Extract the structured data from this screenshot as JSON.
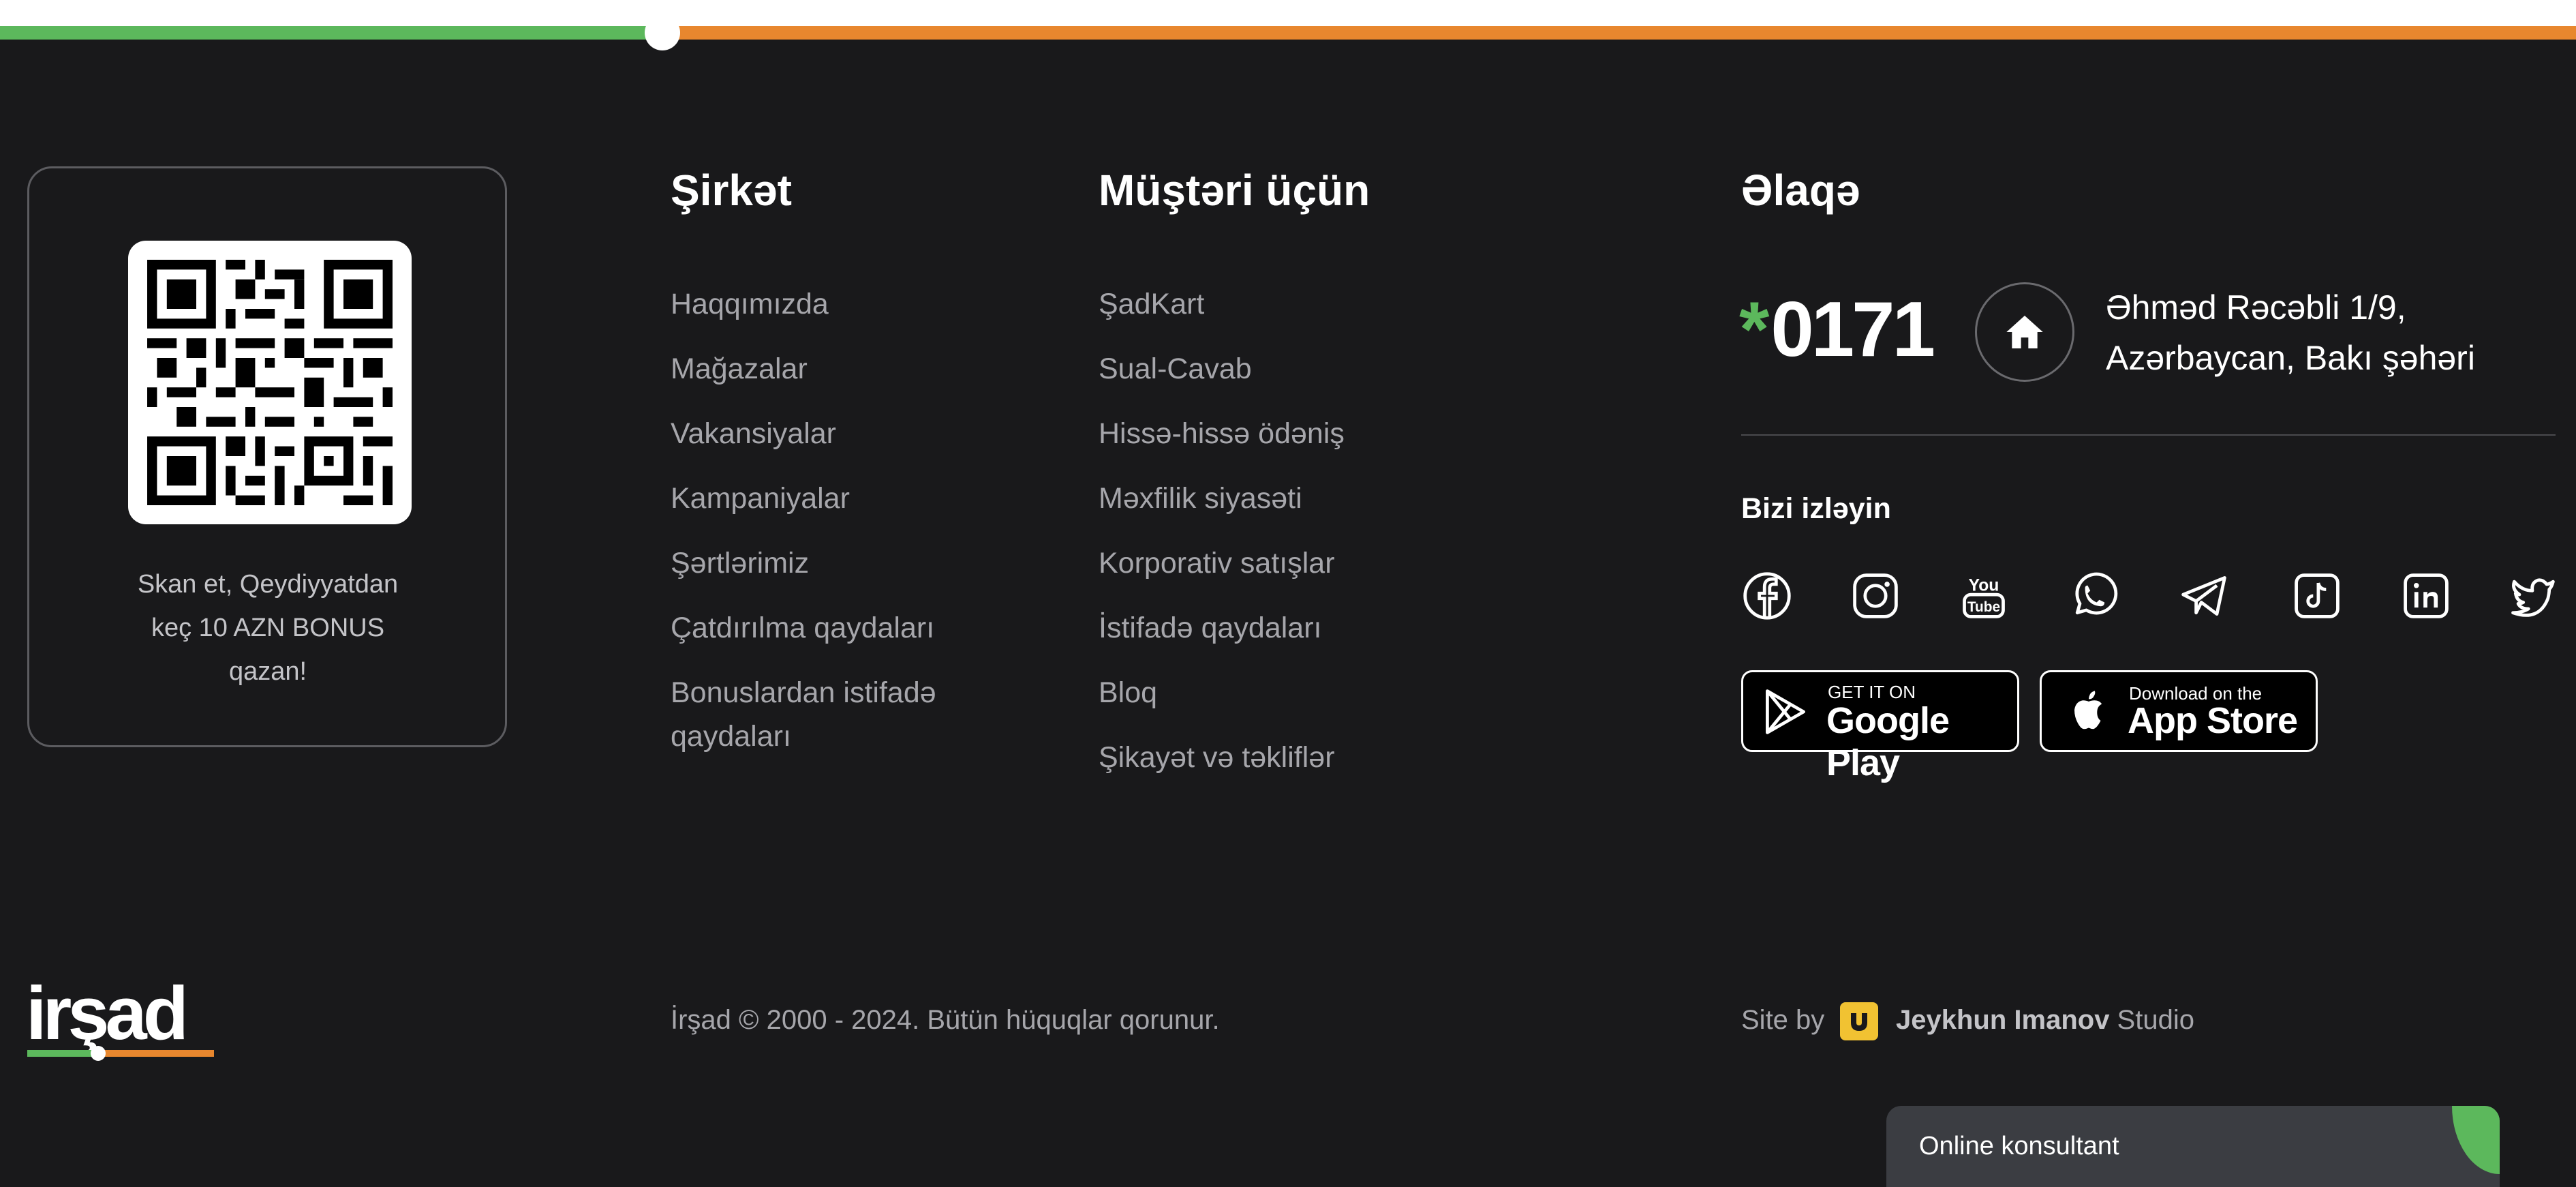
{
  "colors": {
    "accent_green": "#5cb85c",
    "accent_orange": "#e8872e",
    "background": "#19191b"
  },
  "qr": {
    "caption_line1": "Skan et, Qeydiyyatdan",
    "caption_line2": "keç 10 AZN BONUS",
    "caption_line3": "qazan!"
  },
  "company": {
    "title": "Şirkət",
    "links": [
      "Haqqımızda",
      "Mağazalar",
      "Vakansiyalar",
      "Kampaniyalar",
      "Şərtlərimiz",
      "Çatdırılma qaydaları",
      "Bonuslardan istifadə",
      "qaydaları"
    ]
  },
  "customers": {
    "title": "Müştəri üçün",
    "links": [
      "ŞadKart",
      "Sual-Cavab",
      "Hissə-hissə ödəniş",
      "Məxfilik siyasəti",
      "Korporativ satışlar",
      "İstifadə qaydaları",
      "Bloq",
      "Şikayət və təkliflər"
    ]
  },
  "contact": {
    "title": "Əlaqə",
    "phone_star": "*",
    "phone": "0171",
    "home_icon": "home-icon",
    "address_line1": "Əhməd Rəcəbli 1/9,",
    "address_line2": "Azərbaycan, Bakı şəhəri",
    "follow_title": "Bizi izləyin",
    "socials": [
      "facebook-icon",
      "instagram-icon",
      "youtube-icon",
      "whatsapp-icon",
      "telegram-icon",
      "tiktok-icon",
      "linkedin-icon",
      "twitter-icon"
    ],
    "google_play": {
      "small": "GET IT ON",
      "big": "Google Play"
    },
    "app_store": {
      "small": "Download on the",
      "big": "App Store"
    }
  },
  "bottom": {
    "logo_text": "irşad",
    "copyright": "İrşad © 2000 - 2024. Bütün hüquqlar qorunur.",
    "site_by": "Site by",
    "studio_name": "Jeykhun Imanov",
    "studio_suffix": " Studio"
  },
  "chat": {
    "label": "Online konsultant"
  }
}
